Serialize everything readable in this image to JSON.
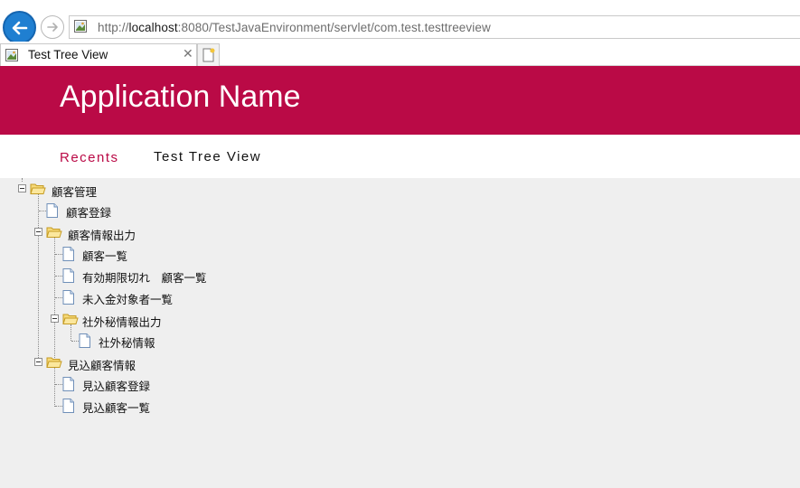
{
  "browser": {
    "url_scheme": "http://",
    "url_host": "localhost",
    "url_rest": ":8080/TestJavaEnvironment/servlet/com.test.testtreeview",
    "tab_title": "Test Tree View",
    "tab_close_glyph": "✕",
    "accent_color": "#1f7fd1"
  },
  "app": {
    "title": "Application Name",
    "brand_color": "#ba0a46",
    "nav": {
      "recents": "Recents",
      "current": "Test Tree View"
    }
  },
  "tree": {
    "nodes": [
      {
        "label": "顧客管理",
        "type": "folder",
        "expanded": true
      },
      {
        "label": "顧客登録",
        "type": "file"
      },
      {
        "label": "顧客情報出力",
        "type": "folder",
        "expanded": true
      },
      {
        "label": "顧客一覧",
        "type": "file"
      },
      {
        "label": "有効期限切れ　顧客一覧",
        "type": "file"
      },
      {
        "label": "未入金対象者一覧",
        "type": "file"
      },
      {
        "label": "社外秘情報出力",
        "type": "folder",
        "expanded": true
      },
      {
        "label": "社外秘情報",
        "type": "file"
      },
      {
        "label": "見込顧客情報",
        "type": "folder",
        "expanded": true
      },
      {
        "label": "見込顧客登録",
        "type": "file"
      },
      {
        "label": "見込顧客一覧",
        "type": "file"
      }
    ]
  }
}
